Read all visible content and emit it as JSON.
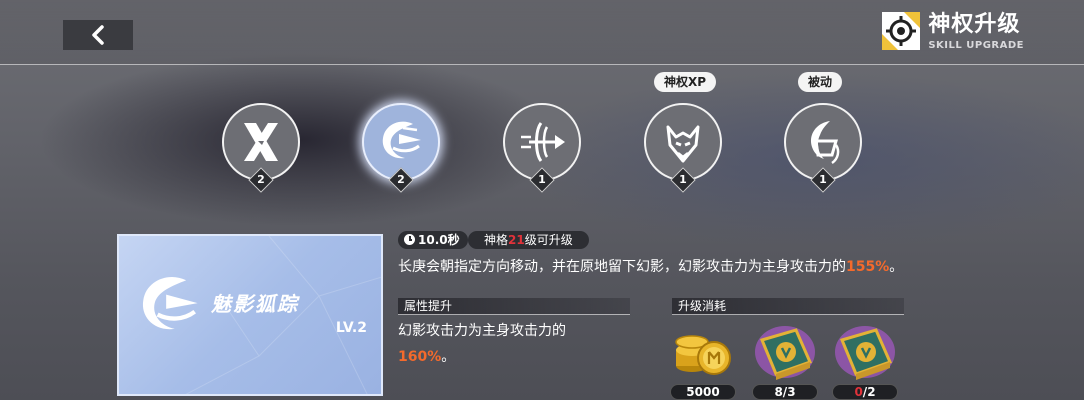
{
  "header": {
    "title_cn": "神权升级",
    "title_en": "SKILL UPGRADE"
  },
  "skills": [
    {
      "level": "2",
      "tag": "",
      "icon": "x-mark-icon",
      "selected": false
    },
    {
      "level": "2",
      "tag": "",
      "icon": "phantom-fox-icon",
      "selected": true
    },
    {
      "level": "1",
      "tag": "",
      "icon": "arrow-dash-icon",
      "selected": false
    },
    {
      "level": "1",
      "tag": "神权XP",
      "icon": "beast-head-icon",
      "selected": false
    },
    {
      "level": "1",
      "tag": "被动",
      "icon": "crescent-mask-icon",
      "selected": false
    }
  ],
  "detail": {
    "skill_name": "魅影狐踪",
    "level_label": "LV.2",
    "cooldown": "10.0秒",
    "requirement_prefix": "神格",
    "requirement_level": "21",
    "requirement_suffix": "级可升级",
    "description_main": "长庚会朝指定方向移动，并在原地留下幻影，幻影攻击力为主身攻击力的",
    "description_value": "155%",
    "description_end": "。"
  },
  "attribute": {
    "heading": "属性提升",
    "line1": "幻影攻击力为主身攻击力的",
    "value": "160%",
    "end": "。"
  },
  "upgrade_cost": {
    "heading": "升级消耗",
    "items": [
      {
        "icon": "gold-coins-icon",
        "owned": "5000",
        "required": ""
      },
      {
        "icon": "skill-book-icon",
        "owned": "8",
        "required": "3"
      },
      {
        "icon": "skill-book-icon",
        "owned": "0",
        "required": "2"
      }
    ]
  },
  "colors": {
    "highlight_orange": "#f46a2c",
    "insufficient_red": "#e0323a",
    "selected_skill": "#9fb4dc"
  }
}
